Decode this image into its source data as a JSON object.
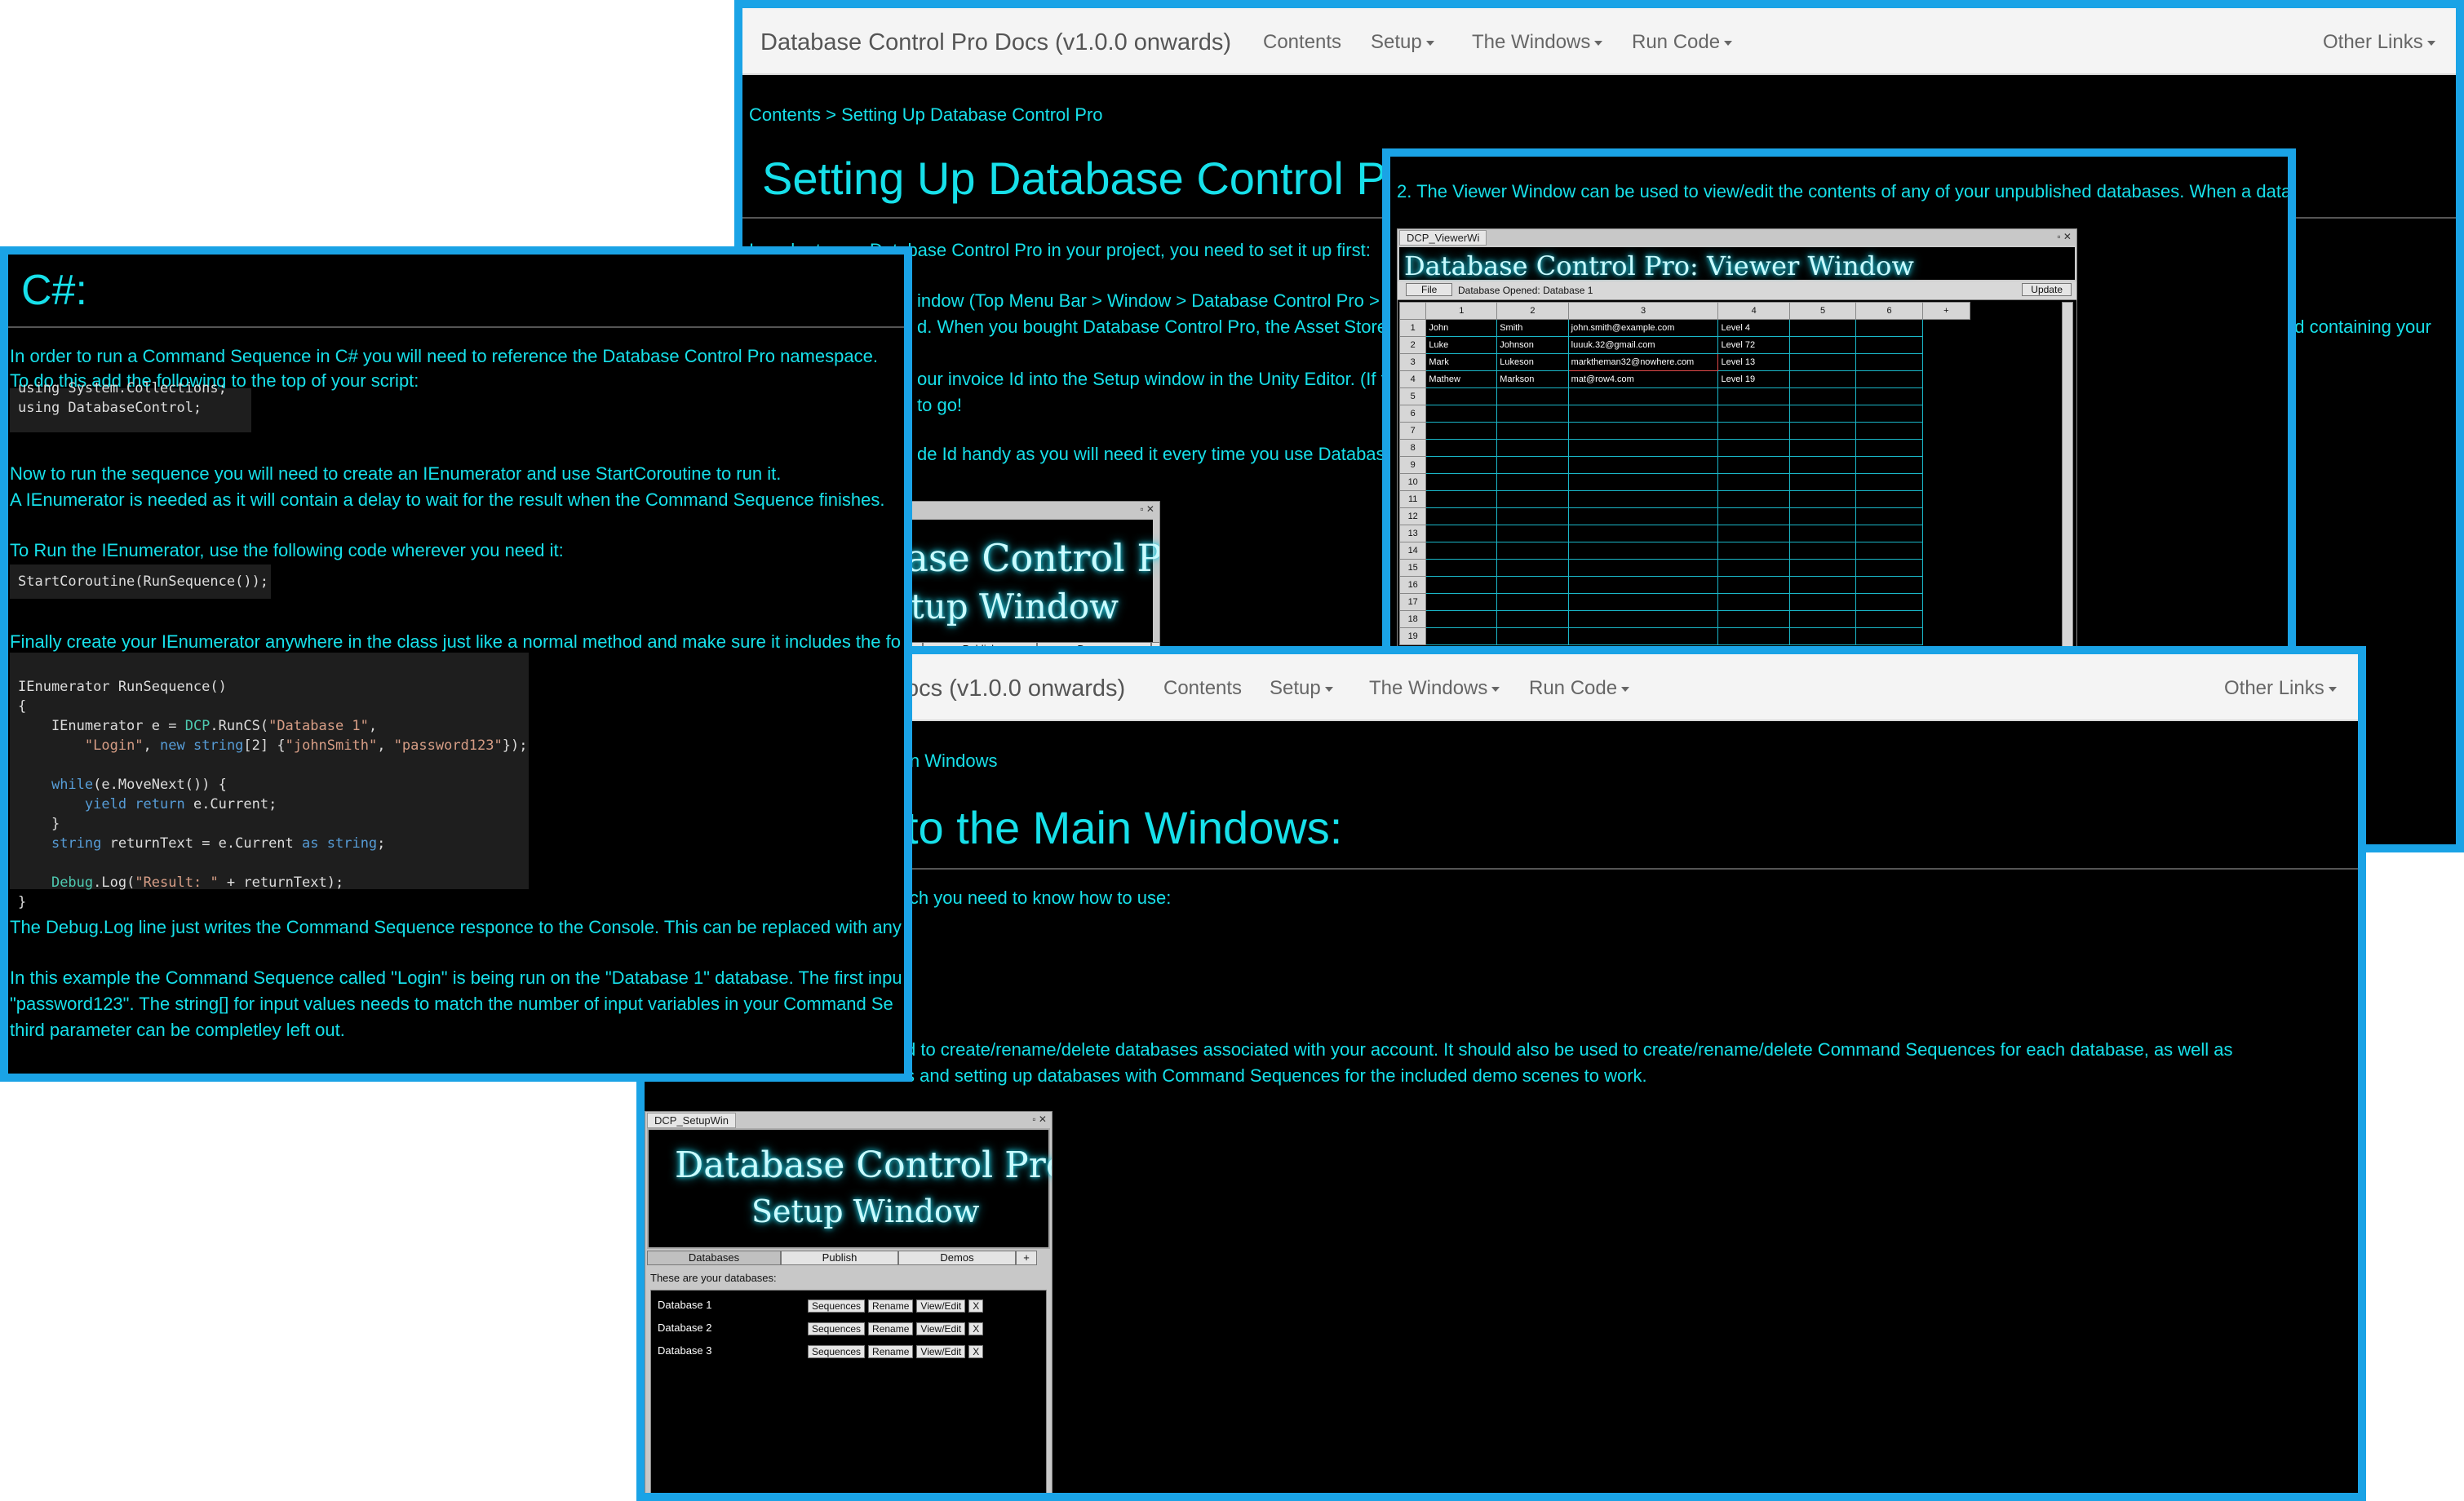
{
  "colors": {
    "frame": "#1aa3e6",
    "text": "#17e0ea",
    "page_bg": "#000000",
    "navbar_bg": "#f4f4f4"
  },
  "nav": {
    "brand": "Database Control Pro Docs (v1.0.0 onwards)",
    "contents": "Contents",
    "setup": "Setup",
    "windows": "The Windows",
    "run_code": "Run Code",
    "other_links": "Other Links",
    "brand_partial": "ocs (v1.0.0 onwards)"
  },
  "setup_page": {
    "breadcrumb": "Contents > Setting Up Database Control Pro",
    "title": "Setting Up Database Control Pr",
    "intro": "In order to use Database Control Pro in your project, you need to set it up first:",
    "line1": "indow (Top Menu Bar > Window > Database Control Pro > S",
    "line2": "d. When you bought Database Control Pro, the Asset Store",
    "line3": "our invoice Id into the Setup window in the Unity Editor. (If th",
    "line4": "to go!",
    "line5": "de Id handy as you will need it every time you use Database",
    "right_edge": "ed containing your"
  },
  "viewer_panel": {
    "text": "2. The Viewer Window can be used to view/edit the contents of any of your unpublished databases. When a data",
    "window_tab": "DCP_ViewerWi",
    "banner": "Database Control Pro: Viewer Window",
    "file_btn": "File",
    "db_opened": "Database Opened: Database 1",
    "update_btn": "Update",
    "col_headers": [
      "1",
      "2",
      "3",
      "4",
      "5",
      "6",
      "+"
    ],
    "rows": [
      [
        "1",
        "John",
        "Smith",
        "john.smith@example.com",
        "Level 4"
      ],
      [
        "2",
        "Luke",
        "Johnson",
        "luuuk.32@gmail.com",
        "Level 72"
      ],
      [
        "3",
        "Mark",
        "Lukeson",
        "marktheman32@nowhere.com",
        "Level 13"
      ],
      [
        "4",
        "Mathew",
        "Markson",
        "mat@row4.com",
        "Level 19"
      ]
    ],
    "empty_rows": [
      "5",
      "6",
      "7",
      "8",
      "9",
      "10",
      "11",
      "12",
      "13",
      "14",
      "15",
      "16",
      "17",
      "18",
      "19"
    ]
  },
  "csharp_panel": {
    "title": "C#:",
    "p1a": "In order to run a Command Sequence in C# you will need to reference the Database Control Pro namespace.",
    "p1b": "To do this add the following to the top of your script:",
    "code1a": "using System.Collections;",
    "code1b": "using DatabaseControl;",
    "p2a": "Now to run the sequence you will need to create an IEnumerator and use StartCoroutine to run it.",
    "p2b": "A IEnumerator is needed as it will contain a delay to wait for the result when the Command Sequence finishes.",
    "p3": "To Run the IEnumerator, use the following code wherever you need it:",
    "code2": "StartCoroutine(RunSequence());",
    "p4": "Finally create your IEnumerator anywhere in the class just like a normal method and make sure it includes the fo",
    "code3": {
      "l1": "IEnumerator RunSequence()",
      "l2": "{",
      "l3a": "    IEnumerator e = ",
      "l3b": "DCP",
      "l3c": ".RunCS(",
      "l3d": "\"Database 1\"",
      "l3e": ",",
      "l4a": "        ",
      "l4b": "\"Login\"",
      "l4c": ", ",
      "l4d": "new",
      "l4e": " ",
      "l4f": "string",
      "l4g": "[2] {",
      "l4h": "\"johnSmith\"",
      "l4i": ", ",
      "l4j": "\"password123\"",
      "l4k": "});",
      "l5a": "    ",
      "l5b": "while",
      "l5c": "(e.MoveNext()) {",
      "l6a": "        ",
      "l6b": "yield return",
      "l6c": " e.Current;",
      "l7": "    }",
      "l8a": "    ",
      "l8b": "string",
      "l8c": " returnText = e.Current ",
      "l8d": "as",
      "l8e": " ",
      "l8f": "string",
      "l8g": ";",
      "l9a": "    ",
      "l9b": "Debug",
      "l9c": ".Log(",
      "l9d": "\"Result: \"",
      "l9e": " + returnText);",
      "l10": "}"
    },
    "p5": "The Debug.Log line just writes the Command Sequence responce to the Console. This can be replaced with any",
    "p6a": "In this example the Command Sequence called \"Login\" is being run on the \"Database 1\" database. The first inpu",
    "p6b": "\"password123\". The string[] for input values needs to match the number of input variables in your Command Se",
    "p6c": "third parameter can be completley left out."
  },
  "setup_window_partial": {
    "banner1": "base Control Pro",
    "banner2": "etup Window",
    "tab_publish": "Publish",
    "tab_demos": "Demos",
    "tab_plus": "+"
  },
  "main_windows_page": {
    "breadcrumb": "in Windows",
    "title": "to the Main Windows:",
    "intro": "ich you need to know how to use:",
    "line1": "d to create/rename/delete databases associated with your account. It should also be used to create/rename/delete Command Sequences for each database, as well as",
    "line2": "s and setting up databases with Command Sequences for the included demo scenes to work."
  },
  "setup_window": {
    "tab_title": "DCP_SetupWin",
    "banner1": "Database Control Pro",
    "banner2": "Setup Window",
    "tab_databases": "Databases",
    "tab_publish": "Publish",
    "tab_demos": "Demos",
    "tab_plus": "+",
    "label": "These are your databases:",
    "databases": [
      "Database 1",
      "Database 2",
      "Database 3"
    ],
    "btn_sequences": "Sequences",
    "btn_rename": "Rename",
    "btn_view": "View/Edit",
    "btn_x": "X"
  }
}
